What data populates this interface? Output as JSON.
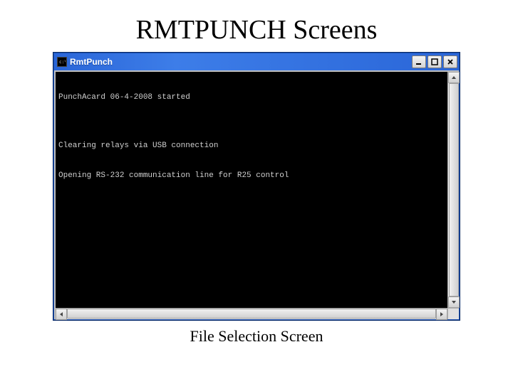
{
  "heading": "RMTPUNCH Screens",
  "caption": "File Selection Screen",
  "window": {
    "title": "RmtPunch",
    "icon_name": "console-icon"
  },
  "console": {
    "lines": [
      "PunchAcard 06-4-2008 started",
      "",
      "Clearing relays via USB connection",
      "Opening RS-232 communication line for R25 control"
    ]
  }
}
